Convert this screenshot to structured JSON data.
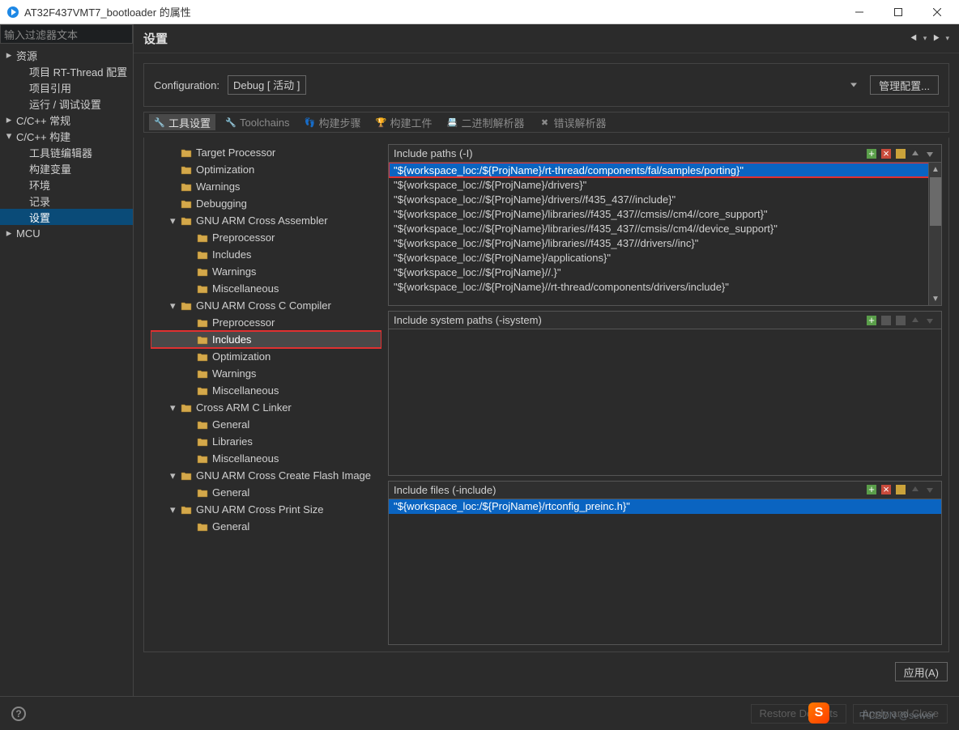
{
  "window": {
    "title": "AT32F437VMT7_bootloader 的属性"
  },
  "left": {
    "filter_placeholder": "输入过滤器文本",
    "items": [
      {
        "label": "资源",
        "level": 0,
        "disc": "▸"
      },
      {
        "label": "项目 RT-Thread 配置",
        "level": 1
      },
      {
        "label": "项目引用",
        "level": 1
      },
      {
        "label": "运行 / 调试设置",
        "level": 1
      },
      {
        "label": "C/C++ 常规",
        "level": 0,
        "disc": "▸"
      },
      {
        "label": "C/C++ 构建",
        "level": 0,
        "disc": "▾"
      },
      {
        "label": "工具链编辑器",
        "level": 1
      },
      {
        "label": "构建变量",
        "level": 1
      },
      {
        "label": "环境",
        "level": 1
      },
      {
        "label": "记录",
        "level": 1
      },
      {
        "label": "设置",
        "level": 1,
        "selected": true
      },
      {
        "label": "MCU",
        "level": 0,
        "disc": "▸"
      }
    ]
  },
  "header": {
    "title": "设置"
  },
  "config": {
    "label": "Configuration:",
    "value": "Debug  [ 活动 ]",
    "manage_btn": "管理配置..."
  },
  "tabs": [
    {
      "label": "工具设置",
      "icon": "wrench-icon",
      "selected": true
    },
    {
      "label": "Toolchains",
      "icon": "wrench-icon"
    },
    {
      "label": "构建步骤",
      "icon": "steps-icon"
    },
    {
      "label": "构建工件",
      "icon": "trophy-icon"
    },
    {
      "label": "二进制解析器",
      "icon": "binary-icon"
    },
    {
      "label": "错误解析器",
      "icon": "x-icon"
    }
  ],
  "settings_tree": [
    {
      "label": "Target Processor",
      "depth": 1
    },
    {
      "label": "Optimization",
      "depth": 1
    },
    {
      "label": "Warnings",
      "depth": 1
    },
    {
      "label": "Debugging",
      "depth": 1
    },
    {
      "label": "GNU ARM Cross Assembler",
      "depth": 1,
      "expand": "▾"
    },
    {
      "label": "Preprocessor",
      "depth": 2
    },
    {
      "label": "Includes",
      "depth": 2
    },
    {
      "label": "Warnings",
      "depth": 2
    },
    {
      "label": "Miscellaneous",
      "depth": 2
    },
    {
      "label": "GNU ARM Cross C Compiler",
      "depth": 1,
      "expand": "▾"
    },
    {
      "label": "Preprocessor",
      "depth": 2
    },
    {
      "label": "Includes",
      "depth": 2,
      "selected": true,
      "boxed": true
    },
    {
      "label": "Optimization",
      "depth": 2
    },
    {
      "label": "Warnings",
      "depth": 2
    },
    {
      "label": "Miscellaneous",
      "depth": 2
    },
    {
      "label": "Cross ARM C Linker",
      "depth": 1,
      "expand": "▾"
    },
    {
      "label": "General",
      "depth": 2
    },
    {
      "label": "Libraries",
      "depth": 2
    },
    {
      "label": "Miscellaneous",
      "depth": 2
    },
    {
      "label": "GNU ARM Cross Create Flash Image",
      "depth": 1,
      "expand": "▾"
    },
    {
      "label": "General",
      "depth": 2
    },
    {
      "label": "GNU ARM Cross Print Size",
      "depth": 1,
      "expand": "▾"
    },
    {
      "label": "General",
      "depth": 2
    }
  ],
  "panel_paths": {
    "title": "Include paths (-I)",
    "rows": [
      {
        "text": "\"${workspace_loc:/${ProjName}/rt-thread/components/fal/samples/porting}\"",
        "selected": true,
        "boxed": true
      },
      {
        "text": "\"${workspace_loc://${ProjName}/drivers}\""
      },
      {
        "text": "\"${workspace_loc://${ProjName}/drivers//f435_437//include}\""
      },
      {
        "text": "\"${workspace_loc://${ProjName}/libraries//f435_437//cmsis//cm4//core_support}\""
      },
      {
        "text": "\"${workspace_loc://${ProjName}/libraries//f435_437//cmsis//cm4//device_support}\""
      },
      {
        "text": "\"${workspace_loc://${ProjName}/libraries//f435_437//drivers//inc}\""
      },
      {
        "text": "\"${workspace_loc://${ProjName}/applications}\""
      },
      {
        "text": "\"${workspace_loc://${ProjName}//.}\""
      },
      {
        "text": "\"${workspace_loc://${ProjName}//rt-thread/components/drivers/include}\""
      }
    ]
  },
  "panel_system": {
    "title": "Include system paths (-isystem)"
  },
  "panel_files": {
    "title": "Include files (-include)",
    "rows": [
      {
        "text": "\"${workspace_loc:/${ProjName}/rtconfig_preinc.h}\"",
        "selected": true
      }
    ]
  },
  "buttons": {
    "apply": "应用(A)",
    "restore": "Restore Defaults",
    "applyclose": "Apply and Close"
  },
  "watermark": "中CSDN @sewer"
}
